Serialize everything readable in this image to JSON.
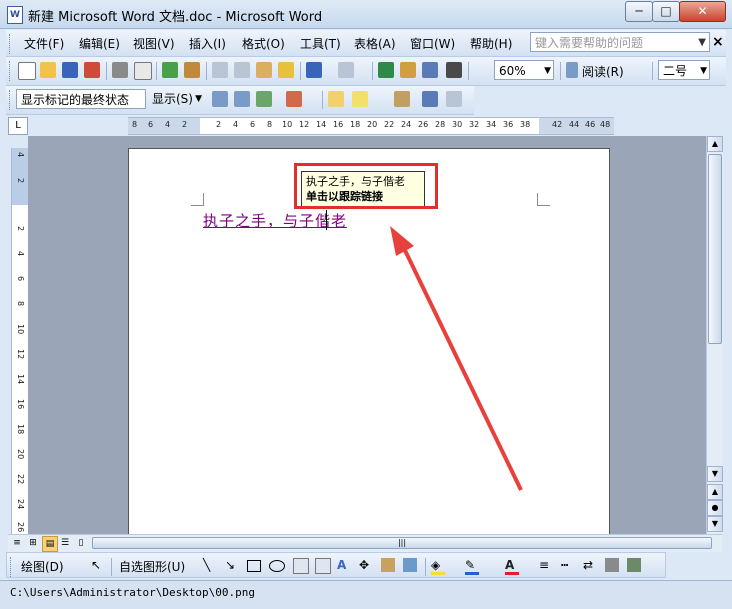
{
  "window": {
    "title": "新建 Microsoft Word 文档.doc - Microsoft Word",
    "icon_label": "W",
    "minimize": "─",
    "maximize": "□",
    "close": "✕"
  },
  "menubar": {
    "items": [
      {
        "label": "文件(F)"
      },
      {
        "label": "编辑(E)"
      },
      {
        "label": "视图(V)"
      },
      {
        "label": "插入(I)"
      },
      {
        "label": "格式(O)"
      },
      {
        "label": "工具(T)"
      },
      {
        "label": "表格(A)"
      },
      {
        "label": "窗口(W)"
      },
      {
        "label": "帮助(H)"
      }
    ],
    "help_search_placeholder": "键入需要帮助的问题",
    "doc_close": "×"
  },
  "toolbar1": {
    "zoom": "60%",
    "read_button": "阅读(R)",
    "font_size": "二号"
  },
  "toolbar2": {
    "markup_mode": "显示标记的最终状态",
    "show_menu": "显示(S)"
  },
  "ruler": {
    "corner": "L",
    "h_numbers": [
      "8",
      "6",
      "4",
      "2",
      "2",
      "4",
      "6",
      "8",
      "10",
      "12",
      "14",
      "16",
      "18",
      "20",
      "22",
      "24",
      "26",
      "28",
      "30",
      "32",
      "34",
      "36",
      "38",
      "42",
      "44",
      "46",
      "48"
    ],
    "v_numbers": [
      "4",
      "2",
      "2",
      "4",
      "6",
      "8",
      "10",
      "12",
      "14",
      "16",
      "18",
      "20",
      "22",
      "24",
      "26"
    ]
  },
  "document": {
    "link_text": "执子之手，与子偕老",
    "tooltip": {
      "line1": "执子之手，与子偕老",
      "line2": "单击以跟踪链接"
    }
  },
  "drawbar": {
    "draw_menu": "绘图(D)",
    "autoshape_menu": "自选图形(U)"
  },
  "statusbar": {
    "path": "C:\\Users\\Administrator\\Desktop\\00.png"
  },
  "colors": {
    "link": "#800080",
    "highlight_box": "#e0302b",
    "tooltip_bg": "#ffffe1"
  }
}
